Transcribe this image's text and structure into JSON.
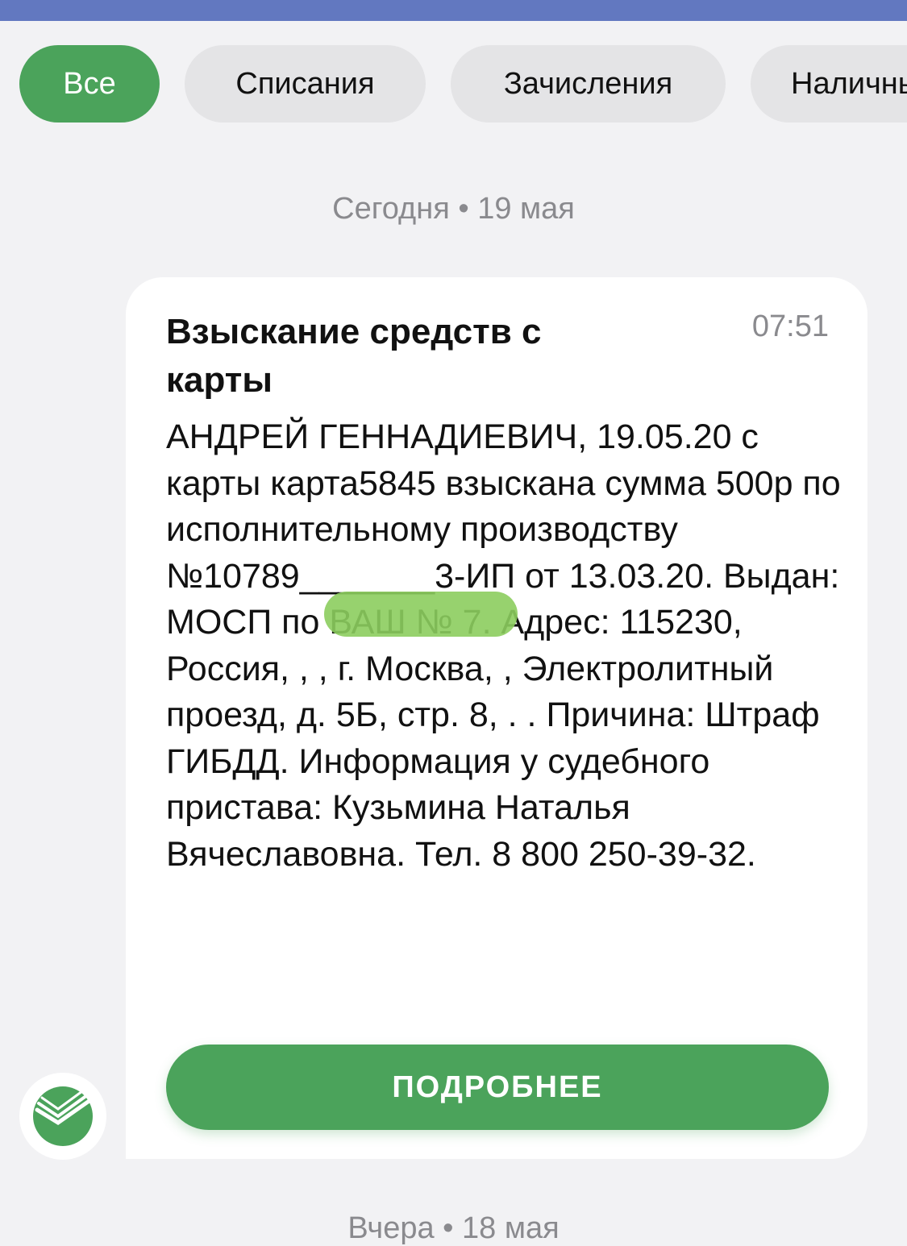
{
  "filters": {
    "items": [
      {
        "label": "Все",
        "active": true
      },
      {
        "label": "Списания",
        "active": false
      },
      {
        "label": "Зачисления",
        "active": false
      },
      {
        "label": "Наличные",
        "active": false
      }
    ]
  },
  "dates": {
    "today": "Сегодня • 19 мая",
    "yesterday": "Вчера • 18 мая"
  },
  "message": {
    "title": "Взыскание средств с карты",
    "time": "07:51",
    "body": "АНДРЕЙ ГЕННАДИЕВИЧ, 19.05.20 с карты карта5845 взыскана сумма 500р по исполнительному производству №10789_______3-ИП от 13.03.20. Выдан: МОСП по ВАШ № 7.  Адрес: 115230, Россия, , , г. Москва, , Электролитный проезд, д. 5Б, стр. 8, . . Причина: Штраф ГИБДД. Информация у судебного пристава: Кузьмина Наталья Вячеславовна. Тел. 8 800 250-39-32.",
    "button_label": "ПОДРОБНЕЕ"
  },
  "icons": {
    "sender_logo": "sberbank-logo-icon"
  },
  "colors": {
    "accent_green": "#4ba35b",
    "top_bar": "#6278c0",
    "background": "#f2f2f4",
    "chip_inactive": "#e4e4e6"
  }
}
